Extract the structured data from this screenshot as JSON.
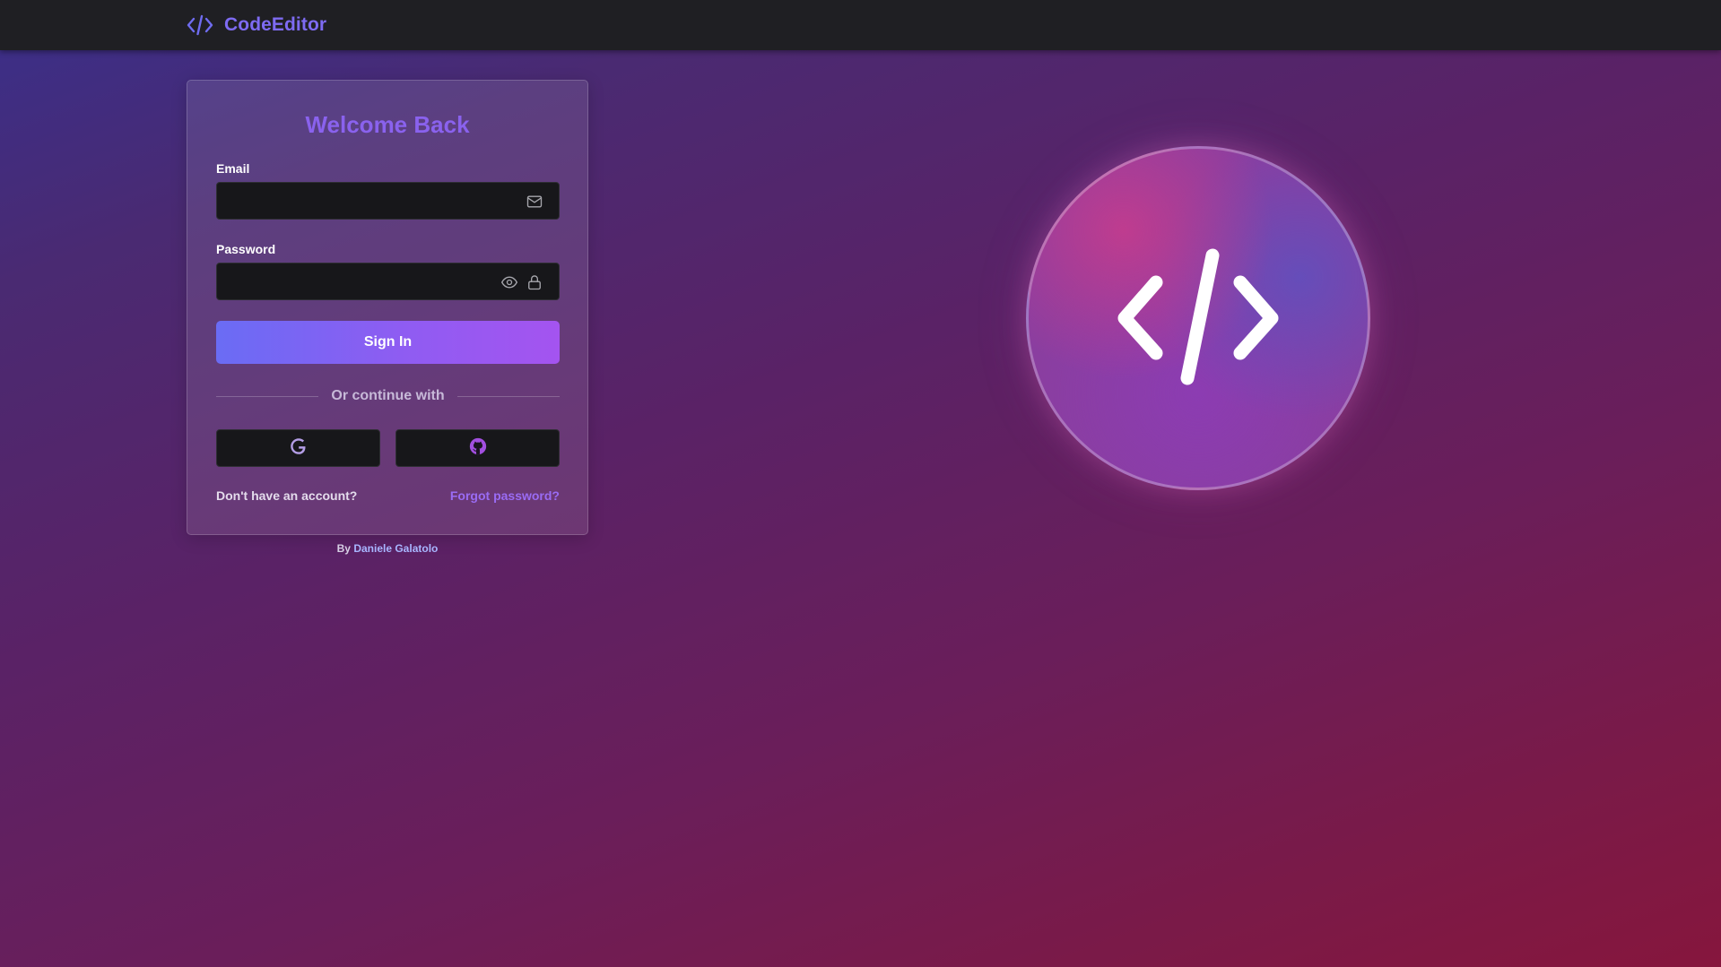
{
  "app": {
    "brand_name": "CodeEditor",
    "brand_icon": "code-icon",
    "accent_color": "#7e6bf2"
  },
  "login": {
    "title": "Welcome Back",
    "email_label": "Email",
    "email_value": "",
    "email_icon": "mail-icon",
    "password_label": "Password",
    "password_value": "",
    "password_icons": [
      "eye-icon",
      "lock-icon"
    ],
    "sign_in_label": "Sign In",
    "divider_text": "Or continue with",
    "social_providers": [
      "google-icon",
      "github-icon"
    ],
    "no_account_text": "Don't have an account?",
    "forgot_password_text": "Forgot password?"
  },
  "footer": {
    "by_text": "By",
    "author": "Daniele Galatolo"
  },
  "hero": {
    "icon": "code-icon"
  }
}
